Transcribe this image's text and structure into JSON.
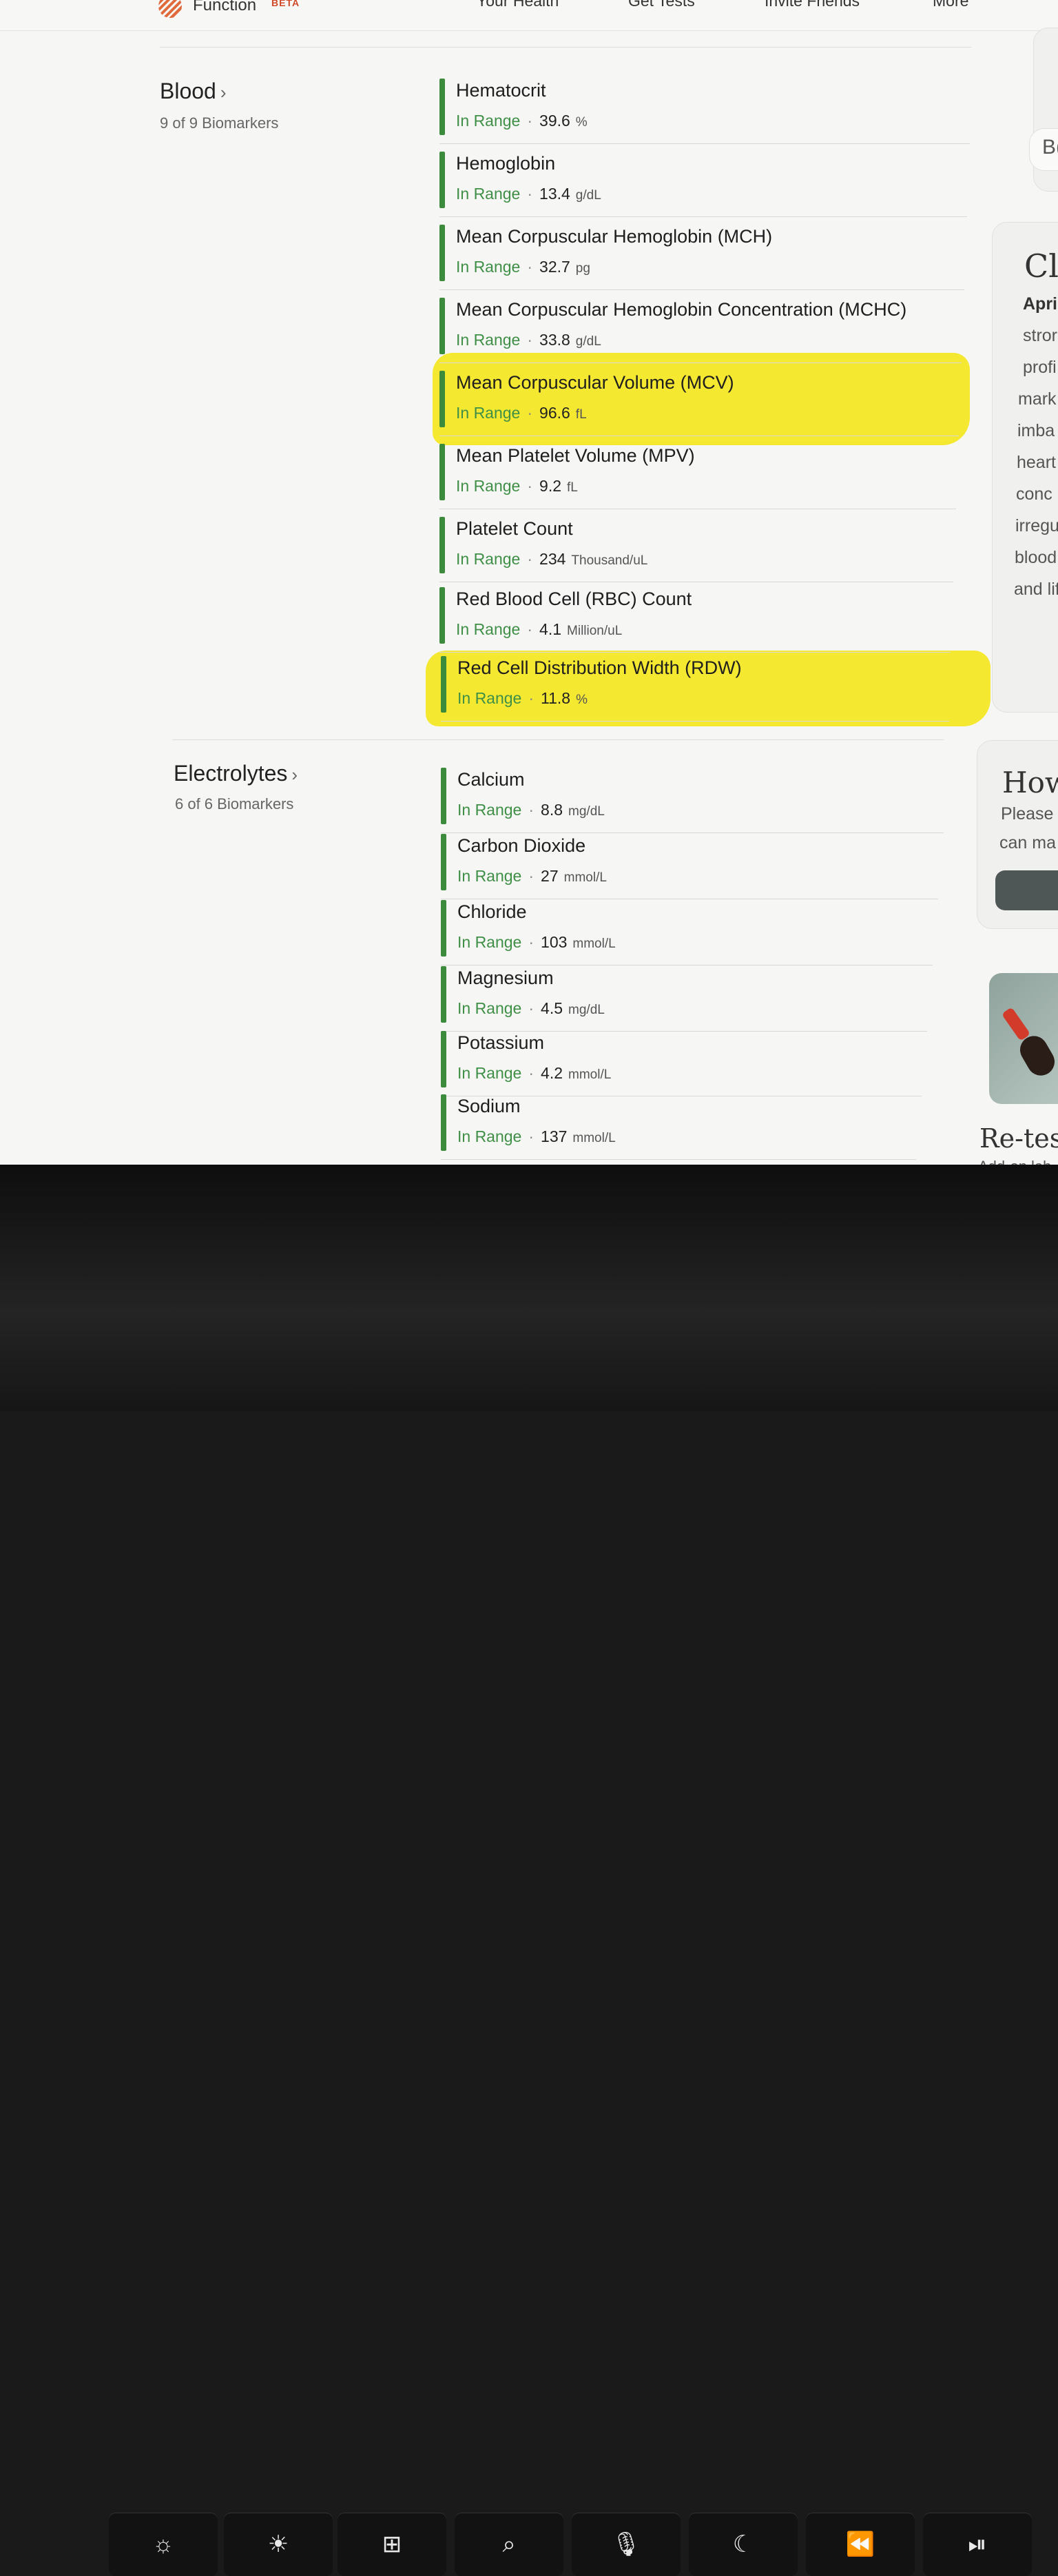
{
  "header": {
    "brand": "Function",
    "badge": "BETA",
    "nav": [
      "Your Health",
      "Get Tests",
      "Invite Friends",
      "More"
    ]
  },
  "sections": [
    {
      "title": "Blood",
      "subtitle": "9 of 9 Biomarkers",
      "items": [
        {
          "name": "Hematocrit",
          "status": "In Range",
          "value": "39.6",
          "unit": "%",
          "highlighted": false
        },
        {
          "name": "Hemoglobin",
          "status": "In Range",
          "value": "13.4",
          "unit": "g/dL",
          "highlighted": false
        },
        {
          "name": "Mean Corpuscular Hemoglobin (MCH)",
          "status": "In Range",
          "value": "32.7",
          "unit": "pg",
          "highlighted": false
        },
        {
          "name": "Mean Corpuscular Hemoglobin Concentration (MCHC)",
          "status": "In Range",
          "value": "33.8",
          "unit": "g/dL",
          "highlighted": false
        },
        {
          "name": "Mean Corpuscular Volume (MCV)",
          "status": "In Range",
          "value": "96.6",
          "unit": "fL",
          "highlighted": true
        },
        {
          "name": "Mean Platelet Volume (MPV)",
          "status": "In Range",
          "value": "9.2",
          "unit": "fL",
          "highlighted": false
        },
        {
          "name": "Platelet Count",
          "status": "In Range",
          "value": "234",
          "unit": "Thousand/uL",
          "highlighted": false
        },
        {
          "name": "Red Blood Cell (RBC) Count",
          "status": "In Range",
          "value": "4.1",
          "unit": "Million/uL",
          "highlighted": false
        },
        {
          "name": "Red Cell Distribution Width (RDW)",
          "status": "In Range",
          "value": "11.8",
          "unit": "%",
          "highlighted": true
        }
      ]
    },
    {
      "title": "Electrolytes",
      "subtitle": "6 of 6 Biomarkers",
      "items": [
        {
          "name": "Calcium",
          "status": "In Range",
          "value": "8.8",
          "unit": "mg/dL",
          "highlighted": false
        },
        {
          "name": "Carbon Dioxide",
          "status": "In Range",
          "value": "27",
          "unit": "mmol/L",
          "highlighted": false
        },
        {
          "name": "Chloride",
          "status": "In Range",
          "value": "103",
          "unit": "mmol/L",
          "highlighted": false
        },
        {
          "name": "Magnesium",
          "status": "In Range",
          "value": "4.5",
          "unit": "mg/dL",
          "highlighted": false
        },
        {
          "name": "Potassium",
          "status": "In Range",
          "value": "4.2",
          "unit": "mmol/L",
          "highlighted": false
        },
        {
          "name": "Sodium",
          "status": "In Range",
          "value": "137",
          "unit": "mmol/L",
          "highlighted": false
        }
      ]
    }
  ],
  "sidebar": {
    "top_button_text": "B(",
    "card1": {
      "heading": "Cl",
      "lines": [
        "Apri",
        "stror",
        "profi",
        "mark",
        "imba",
        "heart",
        "conc",
        "irregu",
        "blood",
        "and lif"
      ]
    },
    "card2": {
      "heading": "How",
      "lines": [
        "Please",
        "can ma"
      ]
    },
    "card3": {
      "heading": "Re-test",
      "sub": "Add-on lab"
    }
  },
  "keyboard": {
    "keys": [
      {
        "label": "☼",
        "icon": "brightness-down-icon"
      },
      {
        "label": "☀",
        "icon": "brightness-up-icon"
      },
      {
        "label": "⊞",
        "icon": "mission-control-icon"
      },
      {
        "label": "⌕",
        "icon": "spotlight-search-icon"
      },
      {
        "label": "🎙",
        "icon": "dictation-microphone-icon"
      },
      {
        "label": "☾",
        "icon": "do-not-disturb-moon-icon"
      },
      {
        "label": "⏪",
        "icon": "rewind-icon"
      },
      {
        "label": "⏯",
        "icon": "play-pause-icon"
      }
    ]
  },
  "colors": {
    "in_range": "#3f8f46",
    "bar": "#3c8a3c",
    "highlighter": "#f4e620"
  }
}
